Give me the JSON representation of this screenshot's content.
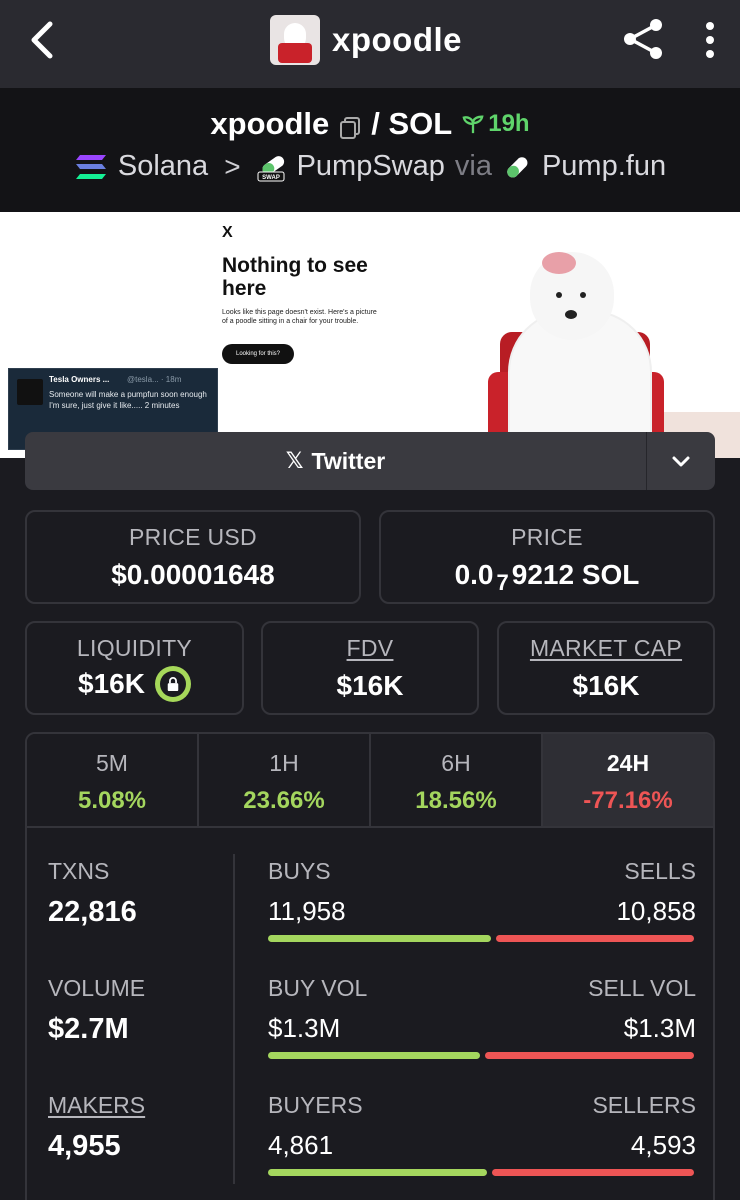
{
  "app": {
    "title": "xpoodle"
  },
  "pair": {
    "base": "xpoodle",
    "separator": "/ SOL",
    "age": "19h",
    "chain": "Solana",
    "dex": "PumpSwap",
    "via": "via",
    "launchpad": "Pump.fun"
  },
  "banner": {
    "x_mark": "X",
    "headline": "Nothing to see here",
    "subtext": "Looks like this page doesn't exist. Here's a picture of a poodle sitting in a chair for your trouble.",
    "button": "Looking for this?",
    "tweet_name": "Tesla Owners ...",
    "tweet_handle": "@tesla... · 18m",
    "tweet_text": "Someone will make a pumpfun soon enough I'm sure, just give it like..... 2 minutes"
  },
  "social": {
    "label": "Twitter"
  },
  "price": {
    "usd_label": "PRICE USD",
    "usd_value": "$0.00001648",
    "native_label": "PRICE",
    "native_prefix": "0.0",
    "native_zeros": "7",
    "native_suffix": "9212 SOL"
  },
  "metrics": {
    "liquidity_label": "LIQUIDITY",
    "liquidity_value": "$16K",
    "fdv_label": "FDV",
    "fdv_value": "$16K",
    "mcap_label": "MARKET CAP",
    "mcap_value": "$16K"
  },
  "timeframes": [
    {
      "label": "5M",
      "value": "5.08%"
    },
    {
      "label": "1H",
      "value": "23.66%"
    },
    {
      "label": "6H",
      "value": "18.56%"
    },
    {
      "label": "24H",
      "value": "-77.16%"
    }
  ],
  "stats": {
    "txns_label": "TXNS",
    "txns_value": "22,816",
    "buys_label": "BUYS",
    "buys_value": "11,958",
    "sells_label": "SELLS",
    "sells_value": "10,858",
    "volume_label": "VOLUME",
    "volume_value": "$2.7M",
    "buyvol_label": "BUY VOL",
    "buyvol_value": "$1.3M",
    "sellvol_label": "SELL VOL",
    "sellvol_value": "$1.3M",
    "makers_label": "MAKERS",
    "makers_value": "4,955",
    "buyers_label": "BUYERS",
    "buyers_value": "4,861",
    "sellers_label": "SELLERS",
    "sellers_value": "4,593"
  },
  "colors": {
    "positive": "#a4d65e",
    "negative": "#ee5555",
    "age_green": "#5fd46b"
  },
  "icons": [
    "back-arrow-icon",
    "share-icon",
    "more-vertical-icon",
    "copy-icon",
    "sprout-icon",
    "solana-logo-icon",
    "pumpswap-icon",
    "pill-icon",
    "x-logo-icon",
    "chevron-down-icon",
    "lock-icon"
  ]
}
